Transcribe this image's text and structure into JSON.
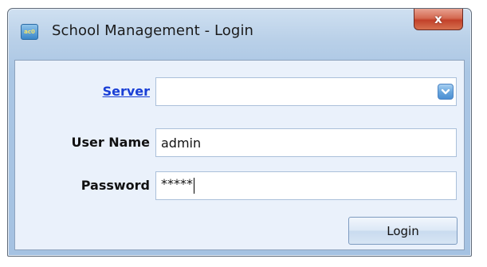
{
  "window": {
    "title": "School Management - Login",
    "close_label": "x",
    "icon_text": "ac0"
  },
  "form": {
    "server": {
      "label": "Server",
      "value": ""
    },
    "username": {
      "label": "User Name",
      "value": "admin"
    },
    "password": {
      "label": "Password",
      "value": "*****"
    },
    "login_button": "Login"
  },
  "icons": {
    "app": "app-icon",
    "close": "close-icon",
    "dropdown": "chevron-down-icon"
  },
  "colors": {
    "link": "#1a3fd6",
    "close_button": "#c2412a",
    "client_background": "#eaf1fb"
  }
}
